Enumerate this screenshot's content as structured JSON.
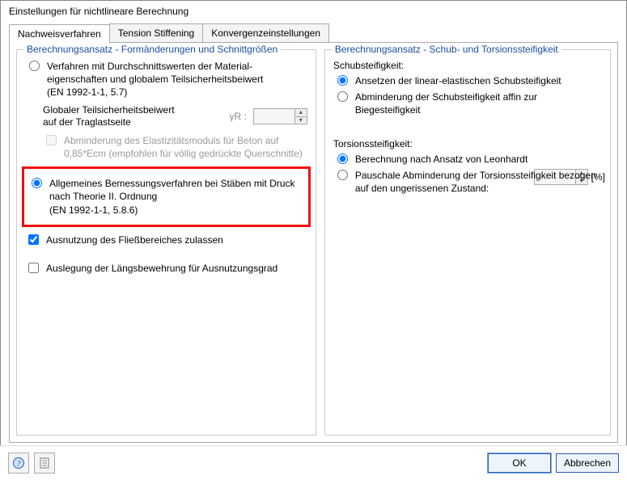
{
  "title": "Einstellungen für nichtlineare Berechnung",
  "tabs": {
    "t0": "Nachweisverfahren",
    "t1": "Tension Stiffening",
    "t2": "Konvergenzeinstellungen"
  },
  "left": {
    "title": "Berechnungsansatz - Formänderungen und Schnittgrößen",
    "opt1": "Verfahren mit Durchschnittswerten der Material-\neigenschaften und globalem Teilsicherheitsbeiwert\n(EN 1992-1-1, 5.7)",
    "gamma_label": "Globaler Teilsicherheitsbeiwert auf der Traglastseite",
    "gamma_sym": "γR :",
    "gamma_val": "",
    "abmind": "Abminderung des Elastizitätsmoduls für Beton auf 0,85*Ecm (empfohlen für völlig gedrückte Querschnitte)",
    "opt2": "Allgemeines Bemessungsverfahren bei Stäben mit Druck nach Theorie II. Ordnung\n(EN 1992-1-1, 5.8.6)",
    "chk_fliess": "Ausnutzung des Fließbereiches zulassen",
    "chk_ausleg": "Auslegung der Längsbewehrung für Ausnutzungsgrad"
  },
  "right": {
    "title": "Berechnungsansatz - Schub- und Torsionssteifigkeit",
    "schub_head": "Schubsteifigkeit:",
    "schub_opt1": "Ansetzen der linear-elastischen Schubsteifigkeit",
    "schub_opt2": "Abminderung der Schubsteifigkeit affin zur Biegesteifigkeit",
    "tors_head": "Torsionssteifigkeit:",
    "tors_opt1": "Berechnung nach Ansatz von Leonhardt",
    "tors_opt2": "Pauschale Abminderung der Torsionssteifigkeit bezogen auf den ungerissenen Zustand:",
    "tors_val": "",
    "pct": "[%]"
  },
  "footer": {
    "ok": "OK",
    "cancel": "Abbrechen"
  }
}
